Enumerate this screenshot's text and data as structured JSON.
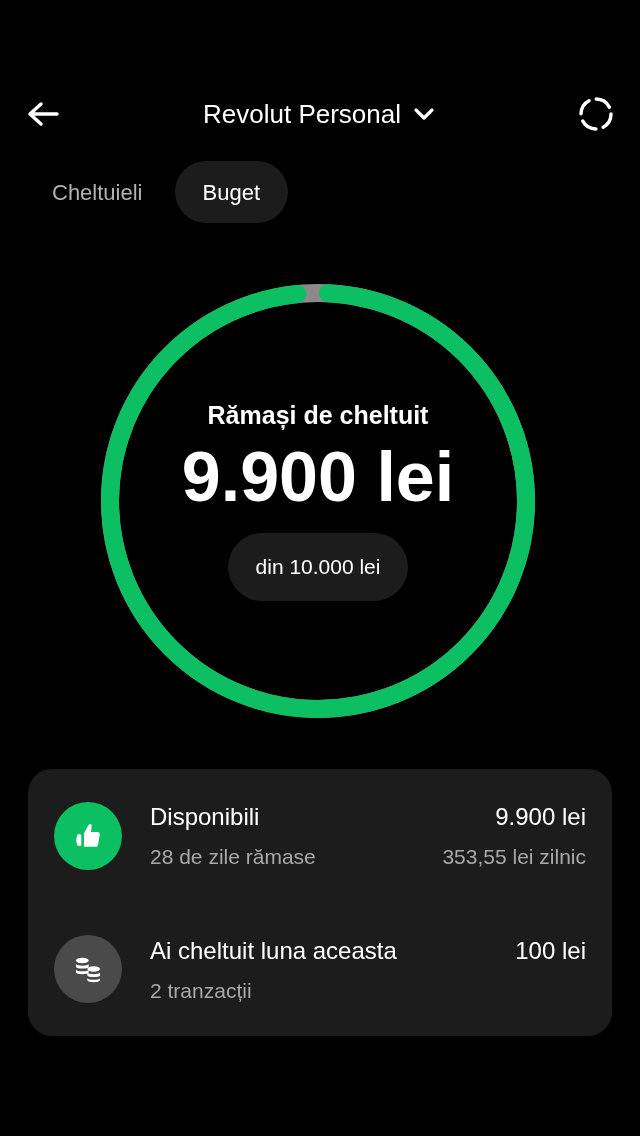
{
  "header": {
    "title": "Revolut Personal"
  },
  "tabs": [
    {
      "label": "Cheltuieli",
      "selected": false
    },
    {
      "label": "Buget",
      "selected": true
    }
  ],
  "budget": {
    "caption": "Rămași de cheltuit",
    "amount": "9.900 lei",
    "total": "din 10.000 lei",
    "level": 0.99
  },
  "summary": [
    {
      "kind": "available",
      "title": "Disponibili",
      "subtitle": "28 de zile rămase",
      "amount": "9.900 lei",
      "detail": "353,55 lei zilnic"
    },
    {
      "kind": "spent",
      "title": "Ai cheltuit luna aceasta",
      "subtitle": "2 tranzacții",
      "amount": "100 lei"
    }
  ]
}
